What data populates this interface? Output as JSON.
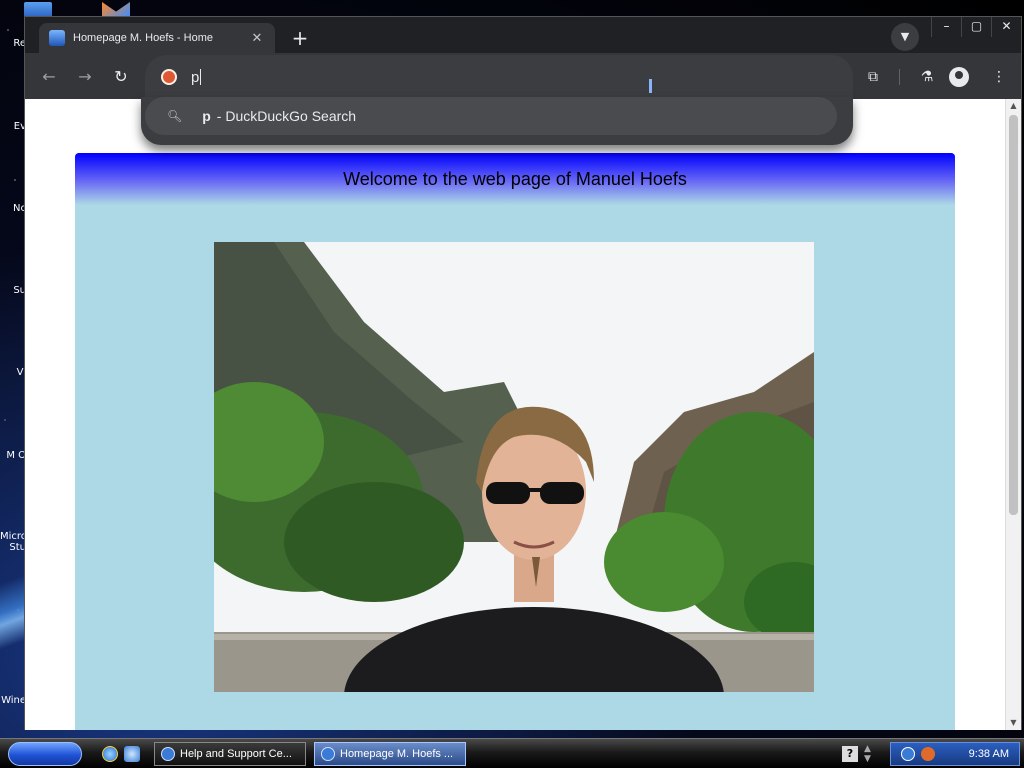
{
  "desktop": {
    "icon_labels": [
      "Re",
      "Ev",
      "Nc",
      "Su",
      "Vi",
      "M O",
      "Micro Stu",
      "Wine"
    ]
  },
  "browser": {
    "tab": {
      "title": "Homepage M. Hoefs - Home",
      "close_glyph": "✕"
    },
    "new_tab_glyph": "+",
    "window_controls": [
      "–",
      "▢",
      "✕"
    ],
    "omnibox": {
      "value": "p"
    },
    "suggestion": {
      "query": "p",
      "text": "- DuckDuckGo Search"
    }
  },
  "page": {
    "heading": "Welcome to the web page of Manuel Hoefs",
    "photo_alt": "Photo of Manuel Hoefs with sunglasses in front of a mountain gorge with palm trees"
  },
  "taskbar": {
    "tasks": [
      {
        "label": "Help and Support Ce...",
        "active": false
      },
      {
        "label": "Homepage M. Hoefs ...",
        "active": true
      }
    ],
    "tray_help": "?",
    "time": "9:38 AM"
  },
  "colors": {
    "page_bg": "#add8e6",
    "header_top": "#0000ff",
    "browser_dark": "#202124",
    "toolbar": "#35363a"
  }
}
